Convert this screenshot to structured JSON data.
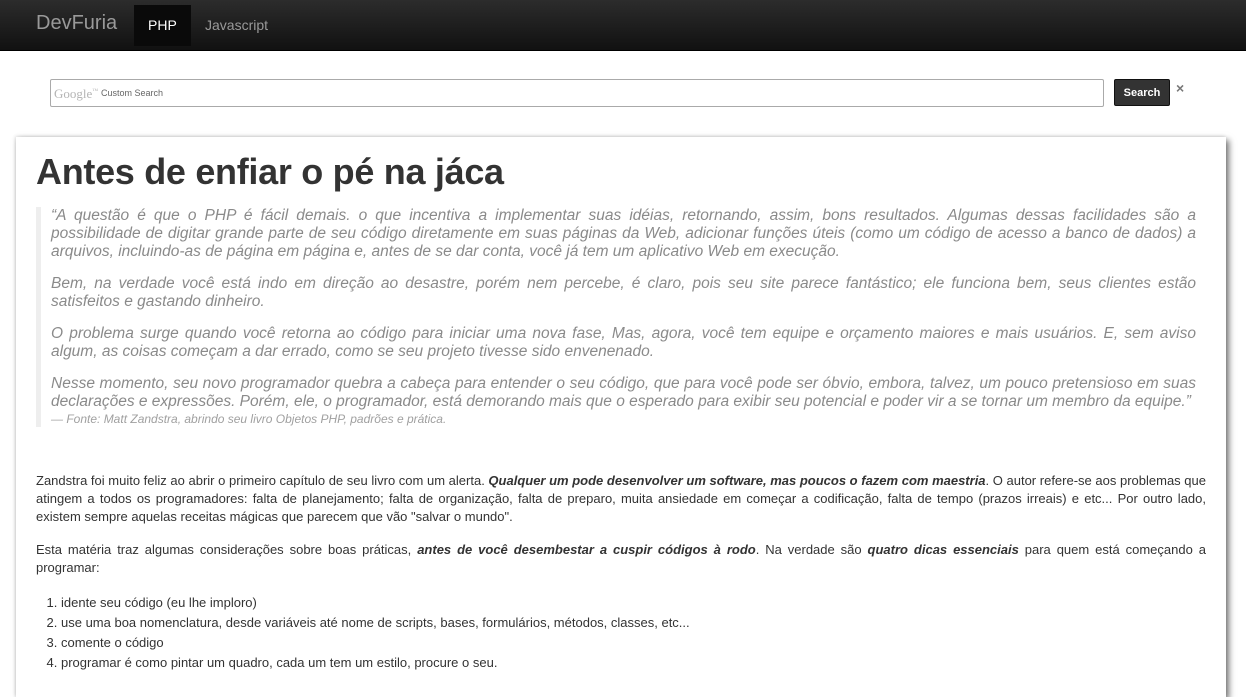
{
  "navbar": {
    "brand": "DevFuria",
    "items": [
      {
        "label": "PHP",
        "active": true
      },
      {
        "label": "Javascript",
        "active": false
      }
    ]
  },
  "search": {
    "logo_text": "Google",
    "logo_tm": "™",
    "placeholder": "Custom Search",
    "value": "",
    "button_label": "Search",
    "clear_label": "×"
  },
  "article": {
    "title": "Antes de enfiar o pé na jáca",
    "quote": {
      "paragraphs": [
        "“A questão é que o PHP é fácil demais. o que incentiva a implementar suas idéias, retornando, assim, bons resultados. Algumas dessas facilidades são a possibilidade de digitar grande parte de seu código diretamente em suas páginas da Web, adicionar funções úteis (como um código de acesso a banco de dados) a arquivos, incluindo-as de página em página e, antes de se dar conta, você já tem um aplicativo Web em execução.",
        "Bem, na verdade você está indo em direção ao desastre, porém nem percebe, é claro, pois seu site parece fantástico; ele funciona bem, seus clientes estão satisfeitos e gastando dinheiro.",
        "O problema surge quando você retorna ao código para iniciar uma nova fase, Mas, agora, você tem equipe e orçamento maiores e mais usuários. E, sem aviso algum, as coisas começam a dar errado, como se seu projeto tivesse sido envenenado.",
        "Nesse momento, seu novo programador quebra a cabeça para entender o seu código, que para você pode ser óbvio, embora, talvez, um pouco pretensioso em suas declarações e expressões. Porém, ele, o programador, está demorando mais que o esperado para exibir seu potencial e poder vir a se tornar um membro da equipe.”"
      ],
      "source": "— Fonte: Matt Zandstra, abrindo seu livro Objetos PHP, padrões e prática."
    },
    "para1": {
      "text_a": "Zandstra foi muito feliz ao abrir o primeiro capítulo de seu livro com um alerta. ",
      "bold_a": "Qualquer um pode desenvolver um software, mas poucos o fazem com maestria",
      "text_b": ". O autor refere-se aos problemas que atingem a todos os programadores: falta de planejamento; falta de organização, falta de preparo, muita ansiedade em começar a codificação, falta de tempo (prazos irreais) e etc... Por outro lado, existem sempre aquelas receitas mágicas que parecem que vão \"salvar o mundo\"."
    },
    "para2": {
      "text_a": "Esta matéria traz algumas considerações sobre boas práticas, ",
      "bold_a": "antes de você desembestar a cuspir códigos à rodo",
      "text_b": ". Na verdade são ",
      "bold_b": "quatro dicas essenciais",
      "text_c": " para quem está começando a programar:"
    },
    "tips": [
      "idente seu código (eu lhe imploro)",
      "use uma boa nomenclatura, desde variáveis até nome de scripts, bases, formulários, métodos, classes, etc...",
      "comente o código",
      "programar é como pintar um quadro, cada um tem um estilo, procure o seu."
    ]
  }
}
